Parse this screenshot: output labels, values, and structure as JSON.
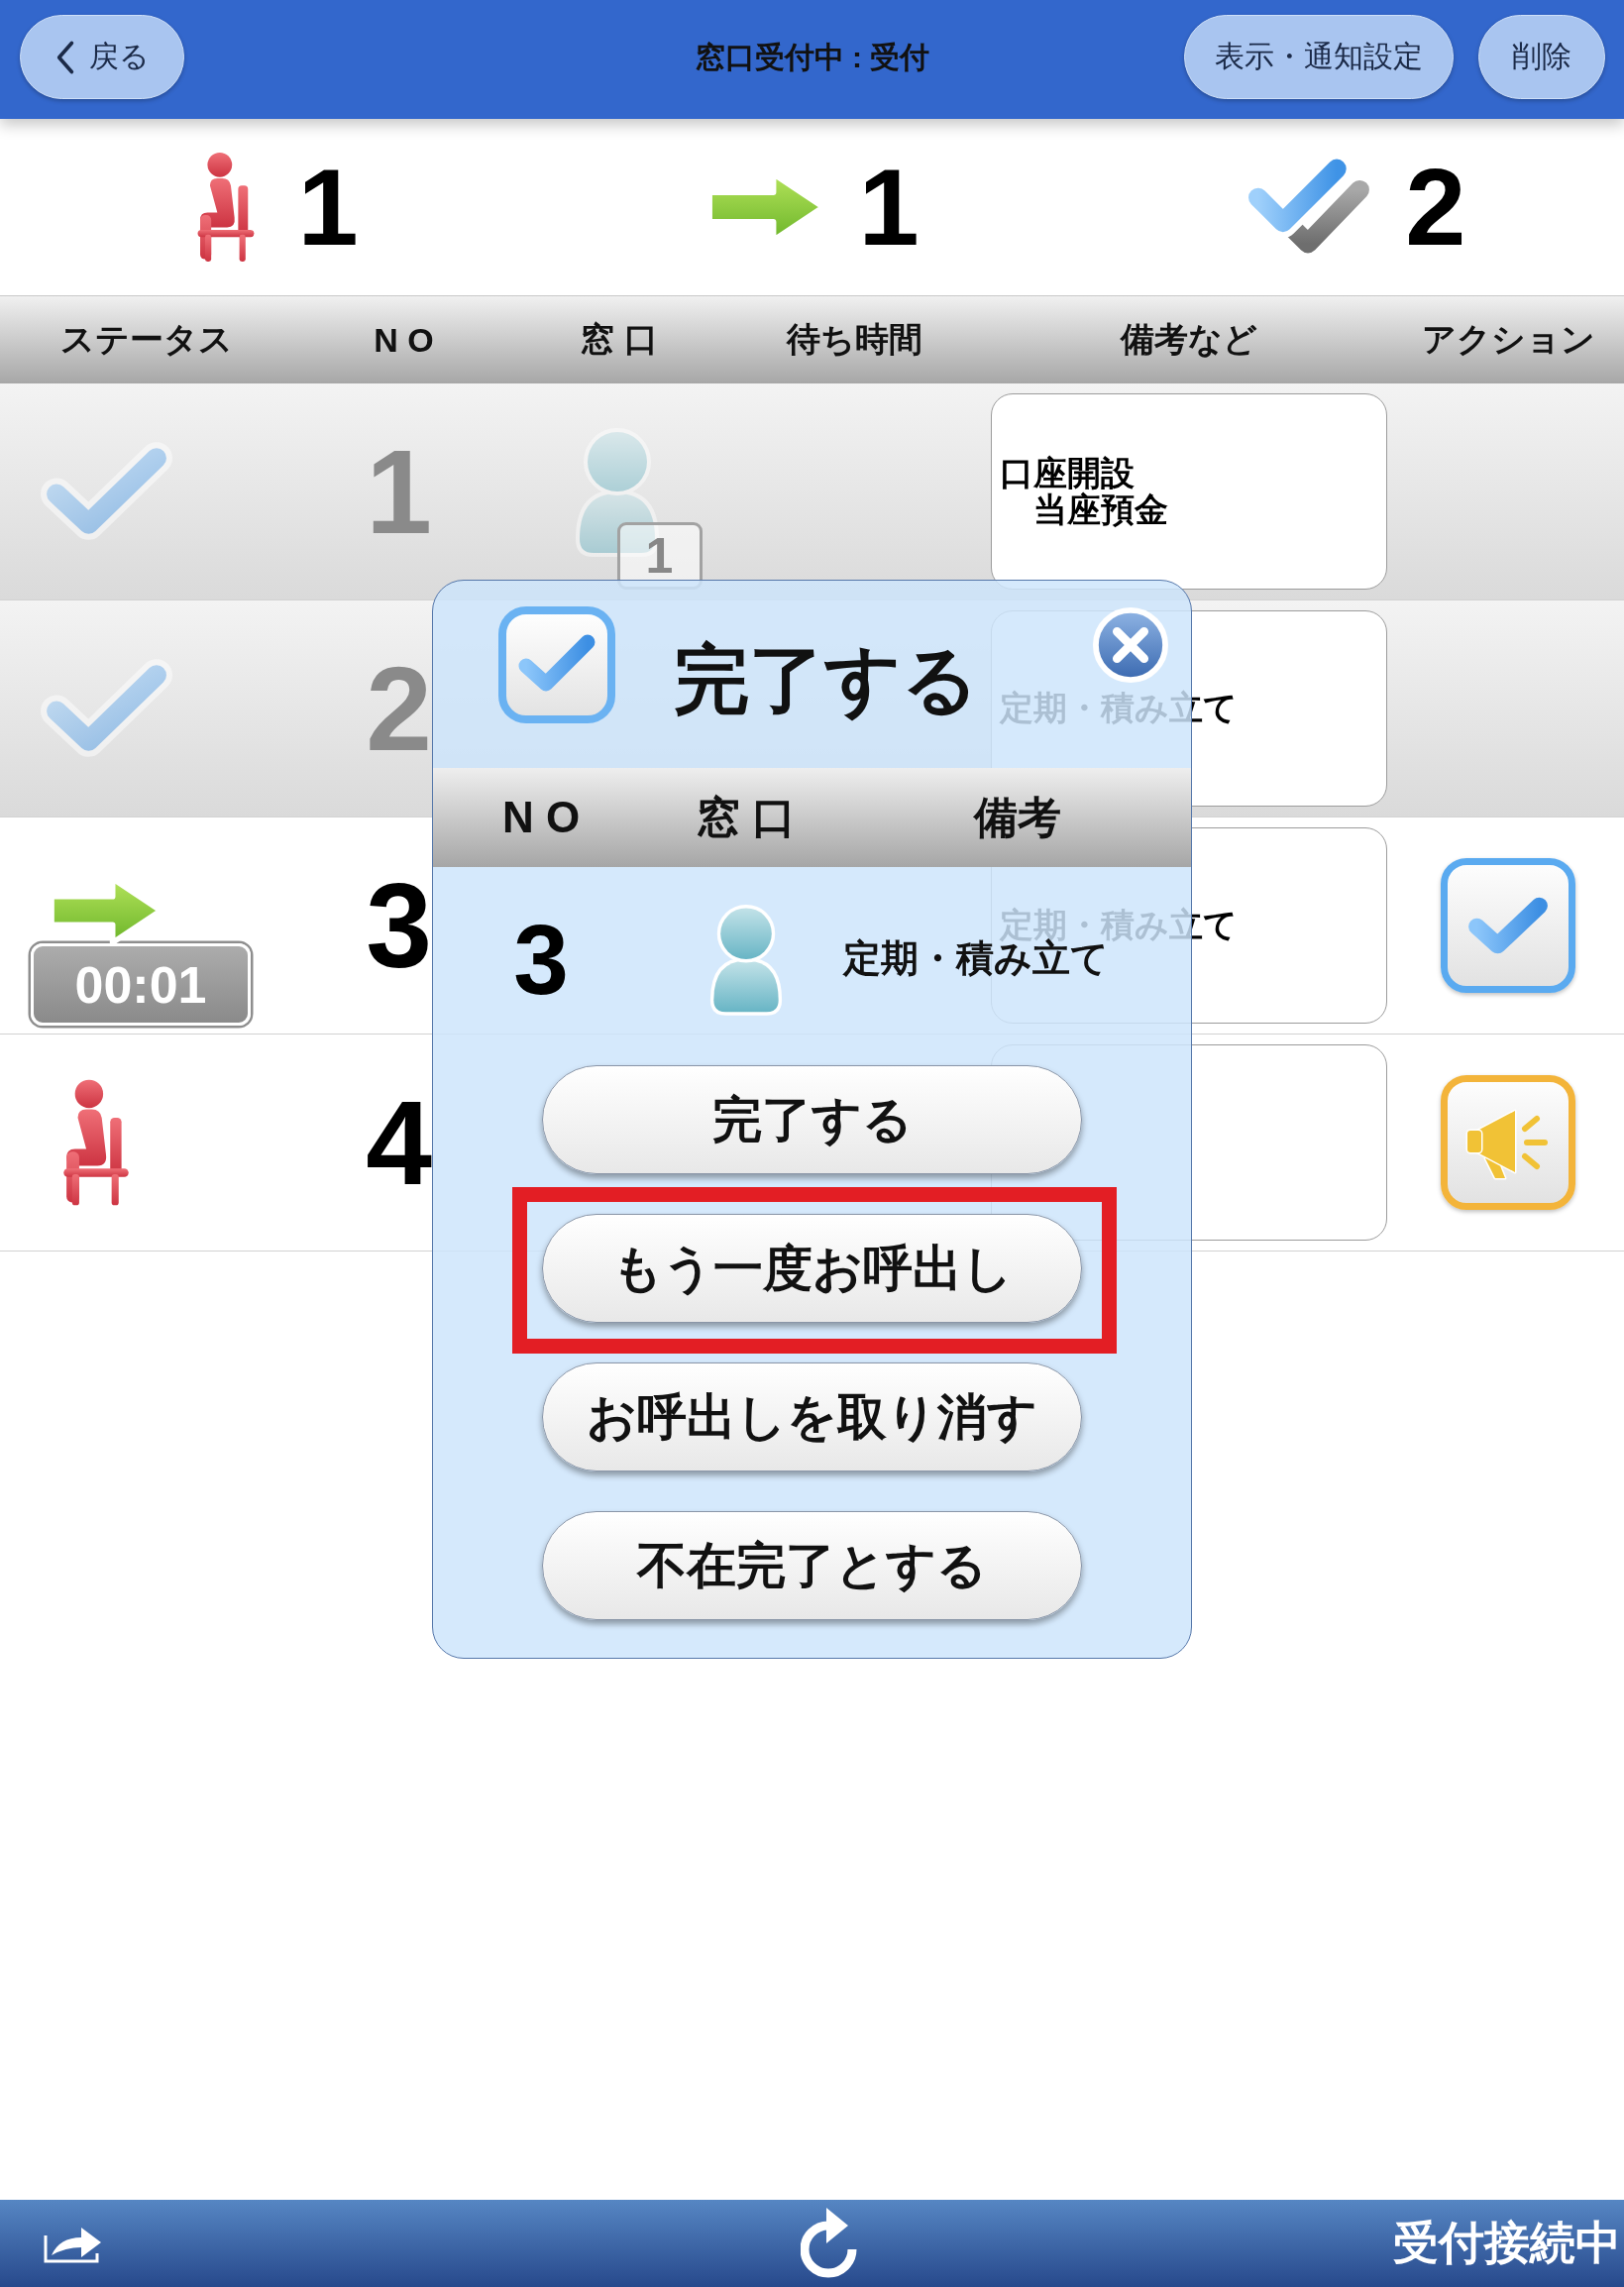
{
  "header": {
    "back_button": "戻る",
    "title": "窓口受付中 : 受付",
    "buttons": [
      "表示・通知設定",
      "削除"
    ]
  },
  "summary": [
    {
      "kind": "waiting",
      "count": "1"
    },
    {
      "kind": "calling",
      "count": "1"
    },
    {
      "kind": "done",
      "count": "2"
    }
  ],
  "table": {
    "columns": [
      "ステータス",
      "N O",
      "窓 口",
      "待ち時間",
      "備考など",
      "アクション"
    ],
    "rows": [
      {
        "kind": "done",
        "no": "1",
        "counter": "1",
        "note": [
          "口座開設",
          "　当座預金"
        ]
      },
      {
        "kind": "done",
        "no": "2",
        "note": [
          "定期・積み立て"
        ]
      },
      {
        "kind": "calling",
        "timer": "00:01",
        "no": "3",
        "note": [
          "定期・積み立て"
        ],
        "action": {
          "kind": "complete"
        }
      },
      {
        "kind": "waiting",
        "no": "4",
        "action": {
          "kind": "call"
        }
      }
    ]
  },
  "dialog": {
    "title": "完了する",
    "columns": [
      "N O",
      "窓 口",
      "備考"
    ],
    "entry": {
      "no": "3",
      "note": "定期・積み立て"
    },
    "buttons": [
      {
        "label": "完了する",
        "highlighted": false
      },
      {
        "label": "もう一度お呼出し",
        "highlighted": true
      },
      {
        "label": "お呼出しを取り消す",
        "highlighted": false
      },
      {
        "label": "不在完了とする",
        "highlighted": false
      }
    ]
  },
  "status_bar": {
    "status": "受付接続中"
  }
}
